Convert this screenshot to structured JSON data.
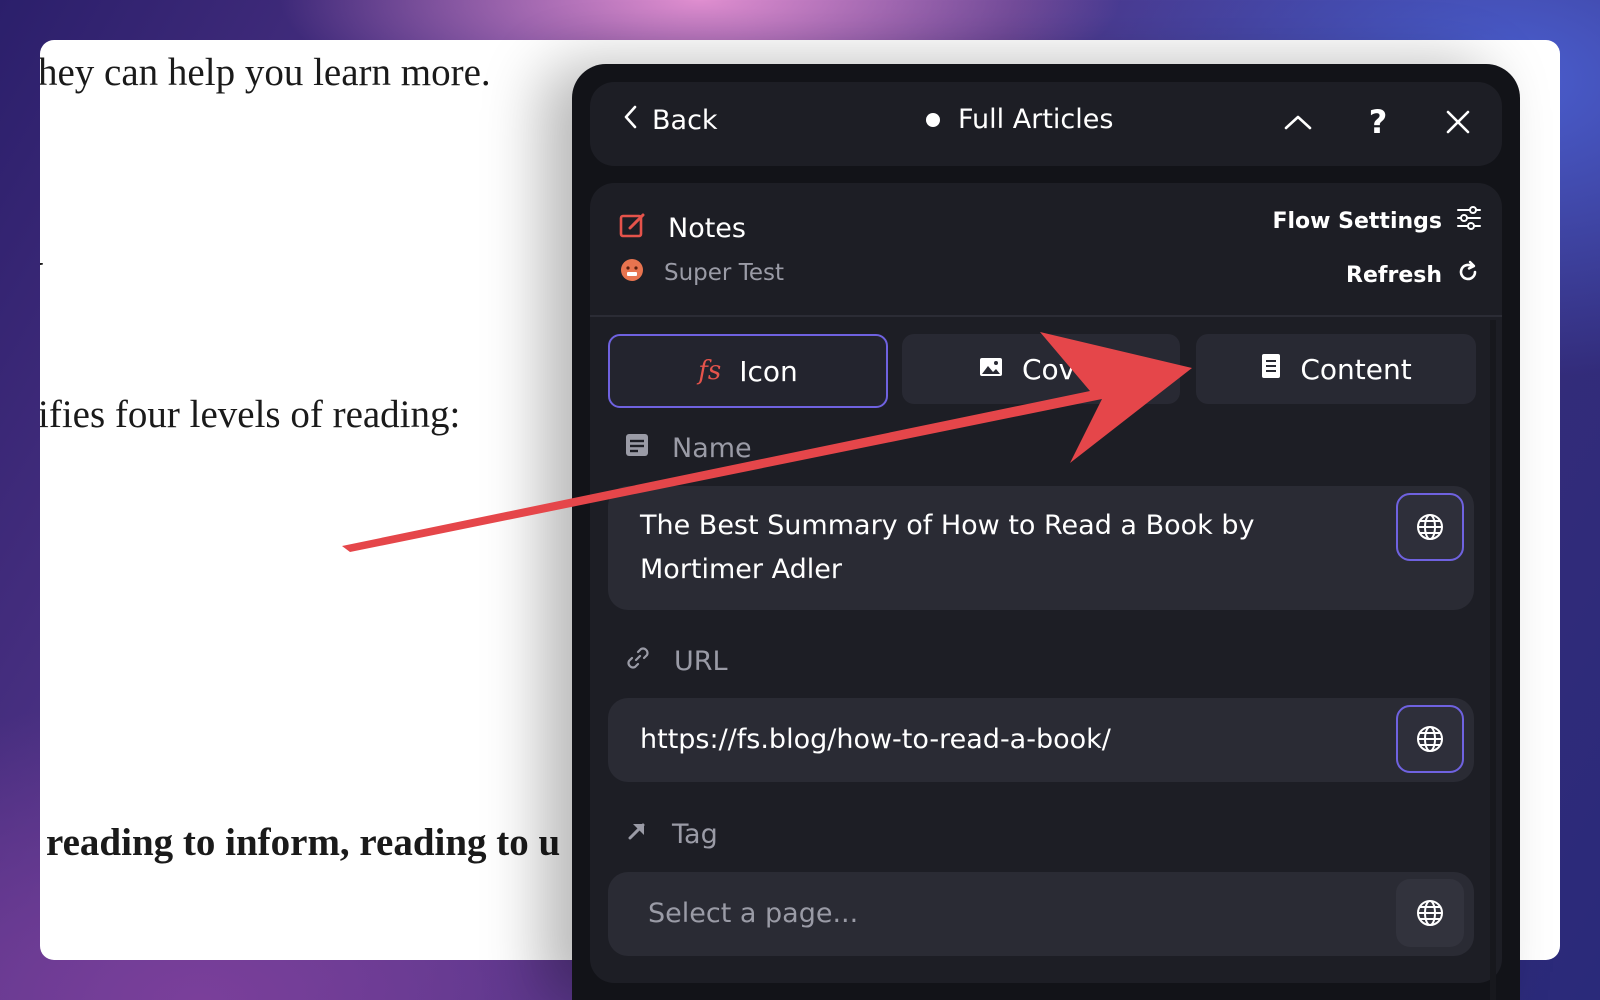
{
  "article": {
    "line1": "hey can help you learn more.",
    "line2": "J",
    "line3": "ifies four levels of reading:",
    "line4": "reading to inform, reading to u"
  },
  "panel": {
    "back_label": "Back",
    "title": "Full Articles",
    "notes_label": "Notes",
    "subtitle": "Super Test",
    "flow_settings_label": "Flow Settings",
    "refresh_label": "Refresh"
  },
  "tabs": [
    {
      "label": "Icon",
      "icon": "fs-script-icon",
      "active": true
    },
    {
      "label": "Cover",
      "icon": "image-icon",
      "active": false
    },
    {
      "label": "Content",
      "icon": "document-icon",
      "active": false
    }
  ],
  "fields": {
    "name": {
      "label": "Name",
      "value_line1": "The Best Summary of How to Read a Book by",
      "value_line2": "Mortimer Adler"
    },
    "url": {
      "label": "URL",
      "value": "https://fs.blog/how-to-read-a-book/"
    },
    "tag": {
      "label": "Tag",
      "placeholder": "Select a page..."
    }
  },
  "colors": {
    "accent": "#6f62e0",
    "notes_icon": "#e5534b",
    "arrow": "#e5464a",
    "panel_bg": "#121318",
    "card_bg": "#1d1e25"
  }
}
